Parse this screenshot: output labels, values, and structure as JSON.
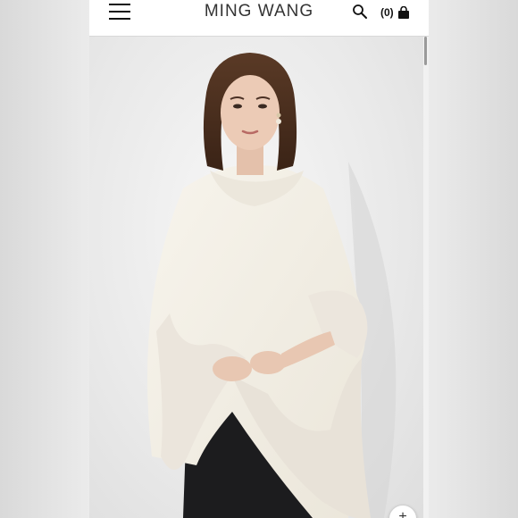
{
  "header": {
    "menu_icon": "hamburger-menu-icon",
    "brand": "MING WANG",
    "search_icon": "search-icon",
    "cart_count": "(0)",
    "cart_icon": "shopping-bag-icon"
  },
  "hero": {
    "image_subject": "model-wearing-ivory-poncho-with-faux-fur-trim"
  },
  "zoom_button": {
    "icon": "plus-icon",
    "label": "+"
  },
  "colors": {
    "header_bg": "#ffffff",
    "brand_text": "#333333",
    "photo_bg": "#ececec",
    "poncho": "#f3efe4",
    "fur": "#ebe5dc",
    "skirt": "#1c1c1e"
  }
}
